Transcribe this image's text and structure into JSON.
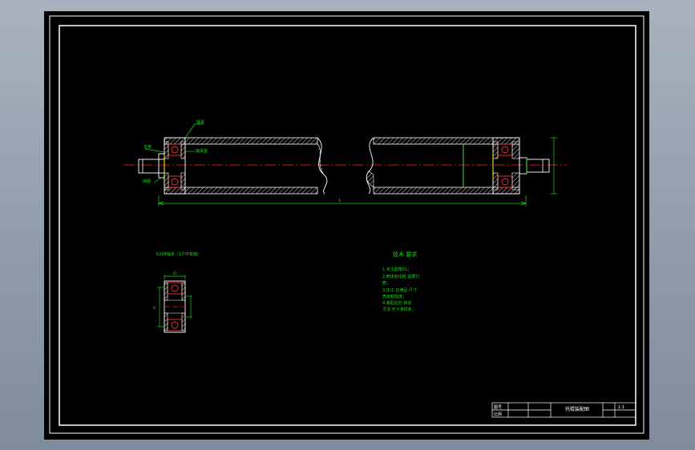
{
  "drawing": {
    "callouts": {
      "shaft_top": "轴承",
      "left_end": "支架",
      "bearing": "轴承座",
      "left_bottom": "挡圈"
    },
    "overall_dim": "L",
    "detail_title": "6204轴承（1个中有轴）",
    "detail_dim_top": "D",
    "detail_dim_left": "d"
  },
  "tech_requirements": {
    "title": "技术 要求",
    "lines": [
      "1.未注圆角R1；",
      "2.筒体各焊缝 需要打",
      "磨；",
      "3.加工 应满足 尺寸",
      "表面粗糙度；",
      "4.装配后应 转动",
      "灵活 无卡滞现象。"
    ]
  },
  "title_block": {
    "name": "托辊装配图",
    "label_a": "图号",
    "label_b": "比例",
    "scale": "1:1"
  },
  "colors": {
    "outline": "#ffffff",
    "centerline": "#ff2020",
    "dimension": "#19d619",
    "text": "#19d619",
    "hatch": "#ffffff",
    "bearing": "#ff3030",
    "yellow": "#ffff33"
  }
}
